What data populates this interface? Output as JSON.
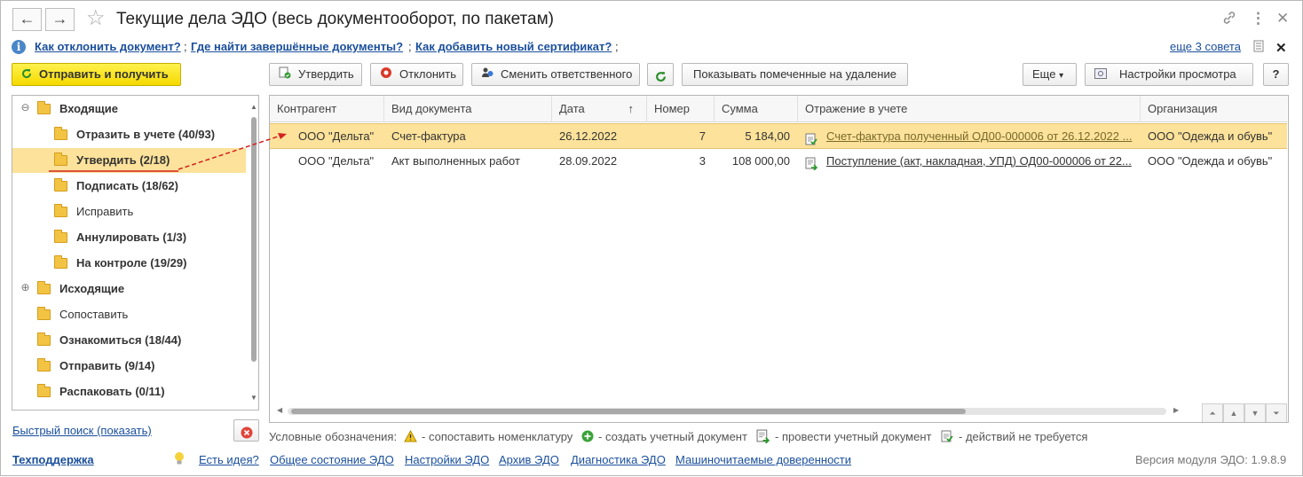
{
  "window": {
    "title": "Текущие дела ЭДО (весь документооборот, по пакетам)",
    "back_glyph": "←",
    "forward_glyph": "→",
    "star_glyph": "☆",
    "link_glyph": "🔗",
    "menu_glyph": "⋮",
    "close_glyph": "✕"
  },
  "tips": {
    "info_glyph": "i",
    "items": [
      "Как отклонить документ?",
      "Где найти завершённые документы?",
      "Как добавить новый сертификат?"
    ],
    "separator": ";",
    "more": "еще 3 совета",
    "close_glyph": "✕"
  },
  "toolbar": {
    "send_receive": "Отправить и получить",
    "approve": "Утвердить",
    "reject": "Отклонить",
    "change_responsible": "Сменить ответственного",
    "show_marked": "Показывать помеченные на удаление",
    "more": "Еще",
    "more_arrow": "▾",
    "view_settings": "Настройки просмотра",
    "help": "?"
  },
  "tree": {
    "items": [
      {
        "label": "Входящие",
        "exp": "⊖"
      },
      {
        "label": "Отразить в учете (40/93)"
      },
      {
        "label": "Утвердить (2/18)"
      },
      {
        "label": "Подписать (18/62)"
      },
      {
        "label": "Исправить"
      },
      {
        "label": "Аннулировать (1/3)"
      },
      {
        "label": "На контроле (19/29)"
      },
      {
        "label": "Исходящие",
        "exp": "⊕"
      },
      {
        "label": "Сопоставить"
      },
      {
        "label": "Ознакомиться (18/44)"
      },
      {
        "label": "Отправить (9/14)"
      },
      {
        "label": "Распаковать (0/11)"
      }
    ]
  },
  "quick_search": "Быстрый поиск (показать)",
  "grid": {
    "columns": [
      "Контрагент",
      "Вид документа",
      "Дата",
      "Номер",
      "Сумма",
      "Отражение в учете",
      "Организация"
    ],
    "sort_glyph": "↑",
    "rows": [
      {
        "counterparty": "ООО \"Дельта\"",
        "doc_type": "Счет-фактура",
        "date": "26.12.2022",
        "number": "7",
        "sum": "5 184,00",
        "accounting": "Счет-фактура полученный ОД00-000006 от 26.12.2022 ...",
        "organization": "ООО \"Одежда и обувь\""
      },
      {
        "counterparty": "ООО \"Дельта\"",
        "doc_type": "Акт выполненных работ",
        "date": "28.09.2022",
        "number": "3",
        "sum": "108 000,00",
        "accounting": "Поступление (акт, накладная, УПД) ОД00-000006 от 22...",
        "organization": "ООО \"Одежда и обувь\""
      }
    ],
    "nav_glyphs": [
      "⏶",
      "▲",
      "▼",
      "⏷"
    ]
  },
  "legend": {
    "title": "Условные обозначения:",
    "items": [
      "- сопоставить номенклатуру",
      "- создать учетный документ",
      "- провести учетный документ",
      "- действий не требуется"
    ]
  },
  "footer": {
    "support": "Техподдержка",
    "links": [
      "Есть идея?",
      "Общее состояние ЭДО",
      "Настройки ЭДО",
      "Архив ЭДО",
      "Диагностика ЭДО",
      "Машиночитаемые доверенности"
    ],
    "version": "Версия модуля ЭДО: 1.9.8.9"
  },
  "colors": {
    "accent_yellow": "#f5d900",
    "selection": "#fce29a",
    "link": "#1a4f9c",
    "arrow_red": "#d42020"
  }
}
